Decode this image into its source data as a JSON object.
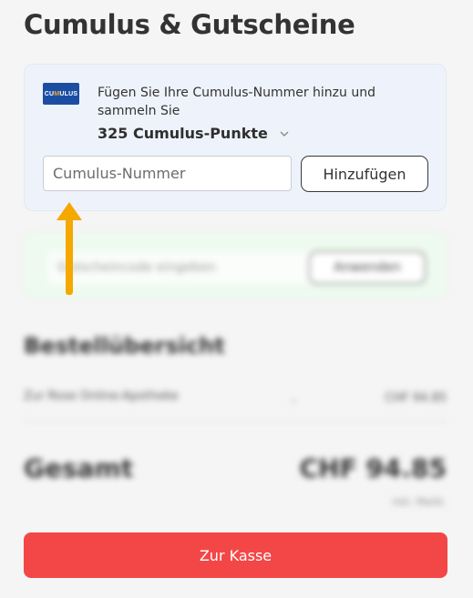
{
  "page": {
    "title": "Cumulus & Gutscheine"
  },
  "cumulus": {
    "logo_text_a": "CU",
    "logo_text_b": "M",
    "logo_text_c": "ULUS",
    "description": "Fügen Sie Ihre Cumulus-Nummer hinzu und sammeln Sie",
    "points": "325 Cumulus-Punkte",
    "input_placeholder": "Cumulus-Nummer",
    "add_button": "Hinzufügen"
  },
  "voucher": {
    "input_placeholder": "Gutscheincode eingeben",
    "apply_button": "Anwenden"
  },
  "summary": {
    "title": "Bestellübersicht",
    "row_label": "Zur Rose Online-Apotheke",
    "row_value": "CHF 94.85",
    "total_label": "Gesamt",
    "total_value": "CHF 94.85",
    "vat_note": "inkl. MwSt."
  },
  "checkout": {
    "button": "Zur Kasse"
  },
  "colors": {
    "accent": "#f34747",
    "cumulus_blue": "#1b4ea3",
    "cumulus_orange": "#f7a21b",
    "arrow": "#f5a800"
  }
}
